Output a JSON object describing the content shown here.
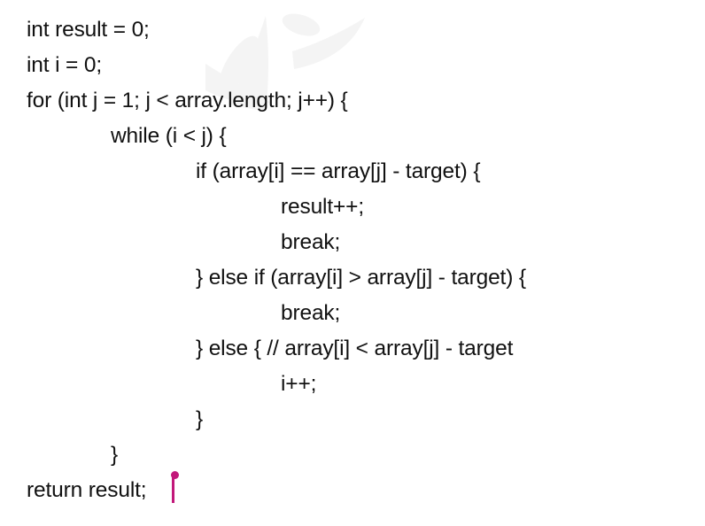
{
  "editor": {
    "lines": [
      "int result = 0;",
      "int i = 0;",
      "for (int j = 1; j < array.length; j++) {",
      "while (i < j) {",
      "if (array[i] == array[j] - target) {",
      "result++;",
      "break;",
      "} else if (array[i] > array[j] - target) {",
      "break;",
      "} else { // array[i] < array[j] - target",
      "i++;",
      "}",
      "}",
      "return result;"
    ]
  },
  "caret": {
    "color": "#c2187a",
    "icon": "text-cursor-icon"
  },
  "watermark": {
    "color": "#f3f3f3",
    "icon": "watermark-logo-icon"
  }
}
